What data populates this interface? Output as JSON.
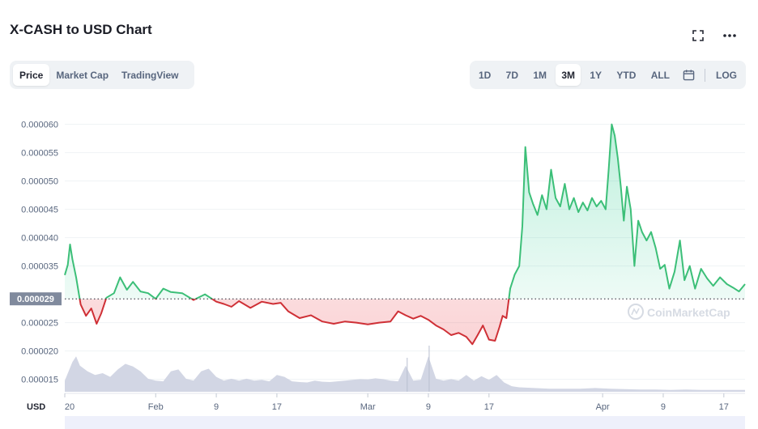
{
  "header": {
    "title": "X-CASH to USD Chart",
    "fullscreen_icon": "fullscreen-icon",
    "more_icon": "more-horizontal-icon"
  },
  "view_tabs": [
    {
      "label": "Price",
      "active": true
    },
    {
      "label": "Market Cap",
      "active": false
    },
    {
      "label": "TradingView",
      "active": false
    }
  ],
  "range_tabs": [
    {
      "label": "1D",
      "active": false
    },
    {
      "label": "7D",
      "active": false
    },
    {
      "label": "1M",
      "active": false
    },
    {
      "label": "3M",
      "active": true
    },
    {
      "label": "1Y",
      "active": false
    },
    {
      "label": "YTD",
      "active": false
    },
    {
      "label": "ALL",
      "active": false
    }
  ],
  "calendar_icon": "calendar-icon",
  "log_label": "LOG",
  "colors": {
    "up": "#16c784",
    "down": "#ea3943",
    "line_up": "#3cbf78",
    "line_down": "#cf3036",
    "volume": "#d2d6e4",
    "grid": "#eff2f5",
    "baseline_badge": "#808a9d"
  },
  "chart_data": {
    "type": "line",
    "currency_label": "USD",
    "y_ticks": [
      "0.000060",
      "0.000055",
      "0.000050",
      "0.000045",
      "0.000040",
      "0.000035",
      "0.000025",
      "0.000020",
      "0.000015"
    ],
    "y_tick_values": [
      6e-05,
      5.5e-05,
      5e-05,
      4.5e-05,
      4e-05,
      3.5e-05,
      2.5e-05,
      2e-05,
      1.5e-05
    ],
    "baseline_label": "0.000029",
    "baseline_value": 2.92e-05,
    "ylim": [
      1.28e-05,
      6.48e-05
    ],
    "x_ticks": [
      {
        "label": "20",
        "day": 0
      },
      {
        "label": "Feb",
        "day": 12
      },
      {
        "label": "9",
        "day": 20
      },
      {
        "label": "17",
        "day": 28
      },
      {
        "label": "Mar",
        "day": 40
      },
      {
        "label": "9",
        "day": 48
      },
      {
        "label": "17",
        "day": 56
      },
      {
        "label": "Apr",
        "day": 71
      },
      {
        "label": "9",
        "day": 79
      },
      {
        "label": "17",
        "day": 87
      }
    ],
    "price_series": [
      [
        0,
        3.34e-05
      ],
      [
        0.4,
        3.52e-05
      ],
      [
        0.7,
        3.88e-05
      ],
      [
        1.0,
        3.62e-05
      ],
      [
        1.5,
        3.3e-05
      ],
      [
        2.1,
        2.82e-05
      ],
      [
        2.8,
        2.62e-05
      ],
      [
        3.5,
        2.75e-05
      ],
      [
        4.2,
        2.48e-05
      ],
      [
        4.8,
        2.66e-05
      ],
      [
        5.5,
        2.94e-05
      ],
      [
        6.5,
        3.02e-05
      ],
      [
        7.3,
        3.3e-05
      ],
      [
        8.2,
        3.08e-05
      ],
      [
        9.0,
        3.22e-05
      ],
      [
        10.0,
        3.05e-05
      ],
      [
        11.0,
        3.02e-05
      ],
      [
        12.0,
        2.92e-05
      ],
      [
        13.0,
        3.1e-05
      ],
      [
        14.0,
        3.04e-05
      ],
      [
        15.5,
        3.02e-05
      ],
      [
        17.0,
        2.9e-05
      ],
      [
        18.5,
        3e-05
      ],
      [
        20.0,
        2.87e-05
      ],
      [
        21.0,
        2.83e-05
      ],
      [
        22.0,
        2.78e-05
      ],
      [
        23.0,
        2.88e-05
      ],
      [
        24.5,
        2.76e-05
      ],
      [
        26.0,
        2.87e-05
      ],
      [
        27.5,
        2.83e-05
      ],
      [
        28.5,
        2.85e-05
      ],
      [
        29.5,
        2.7e-05
      ],
      [
        31.0,
        2.58e-05
      ],
      [
        32.5,
        2.63e-05
      ],
      [
        34.0,
        2.52e-05
      ],
      [
        35.5,
        2.48e-05
      ],
      [
        37.0,
        2.52e-05
      ],
      [
        38.5,
        2.5e-05
      ],
      [
        40.0,
        2.47e-05
      ],
      [
        41.5,
        2.5e-05
      ],
      [
        43.0,
        2.52e-05
      ],
      [
        44.0,
        2.7e-05
      ],
      [
        45.0,
        2.63e-05
      ],
      [
        46.0,
        2.57e-05
      ],
      [
        47.0,
        2.62e-05
      ],
      [
        48.0,
        2.55e-05
      ],
      [
        49.0,
        2.45e-05
      ],
      [
        50.0,
        2.38e-05
      ],
      [
        51.0,
        2.28e-05
      ],
      [
        52.0,
        2.32e-05
      ],
      [
        53.0,
        2.25e-05
      ],
      [
        53.8,
        2.12e-05
      ],
      [
        54.5,
        2.28e-05
      ],
      [
        55.2,
        2.45e-05
      ],
      [
        56.0,
        2.2e-05
      ],
      [
        56.8,
        2.18e-05
      ],
      [
        57.4,
        2.43e-05
      ],
      [
        57.8,
        2.62e-05
      ],
      [
        58.3,
        2.58e-05
      ],
      [
        58.8,
        3.1e-05
      ],
      [
        59.4,
        3.35e-05
      ],
      [
        60.0,
        3.5e-05
      ],
      [
        60.4,
        4.2e-05
      ],
      [
        60.8,
        5.6e-05
      ],
      [
        61.3,
        4.8e-05
      ],
      [
        61.8,
        4.6e-05
      ],
      [
        62.4,
        4.4e-05
      ],
      [
        63.0,
        4.75e-05
      ],
      [
        63.6,
        4.5e-05
      ],
      [
        64.2,
        5.2e-05
      ],
      [
        64.8,
        4.7e-05
      ],
      [
        65.4,
        4.55e-05
      ],
      [
        66.0,
        4.95e-05
      ],
      [
        66.6,
        4.5e-05
      ],
      [
        67.2,
        4.7e-05
      ],
      [
        67.8,
        4.45e-05
      ],
      [
        68.4,
        4.62e-05
      ],
      [
        69.0,
        4.48e-05
      ],
      [
        69.6,
        4.7e-05
      ],
      [
        70.2,
        4.55e-05
      ],
      [
        70.8,
        4.65e-05
      ],
      [
        71.4,
        4.5e-05
      ],
      [
        71.8,
        5.2e-05
      ],
      [
        72.2,
        6e-05
      ],
      [
        72.6,
        5.8e-05
      ],
      [
        73.0,
        5.4e-05
      ],
      [
        73.4,
        4.9e-05
      ],
      [
        73.8,
        4.3e-05
      ],
      [
        74.2,
        4.9e-05
      ],
      [
        74.7,
        4.5e-05
      ],
      [
        75.2,
        3.5e-05
      ],
      [
        75.7,
        4.3e-05
      ],
      [
        76.2,
        4.1e-05
      ],
      [
        76.8,
        3.95e-05
      ],
      [
        77.4,
        4.1e-05
      ],
      [
        78.0,
        3.82e-05
      ],
      [
        78.6,
        3.45e-05
      ],
      [
        79.2,
        3.52e-05
      ],
      [
        79.8,
        3.1e-05
      ],
      [
        80.5,
        3.4e-05
      ],
      [
        81.2,
        3.95e-05
      ],
      [
        81.8,
        3.25e-05
      ],
      [
        82.5,
        3.5e-05
      ],
      [
        83.2,
        3.1e-05
      ],
      [
        84.0,
        3.45e-05
      ],
      [
        84.8,
        3.28e-05
      ],
      [
        85.6,
        3.15e-05
      ],
      [
        86.5,
        3.3e-05
      ],
      [
        87.4,
        3.18e-05
      ],
      [
        88.2,
        3.12e-05
      ],
      [
        89.0,
        3.05e-05
      ],
      [
        89.8,
        3.18e-05
      ]
    ],
    "volume_series": [
      [
        0,
        0.3
      ],
      [
        1,
        0.8
      ],
      [
        1.5,
        0.95
      ],
      [
        2,
        0.7
      ],
      [
        3,
        0.55
      ],
      [
        4,
        0.45
      ],
      [
        5,
        0.5
      ],
      [
        6,
        0.4
      ],
      [
        7,
        0.6
      ],
      [
        8,
        0.75
      ],
      [
        9,
        0.68
      ],
      [
        10,
        0.55
      ],
      [
        11,
        0.35
      ],
      [
        12,
        0.3
      ],
      [
        13,
        0.28
      ],
      [
        14,
        0.55
      ],
      [
        15,
        0.6
      ],
      [
        16,
        0.35
      ],
      [
        17,
        0.3
      ],
      [
        18,
        0.55
      ],
      [
        19,
        0.62
      ],
      [
        20,
        0.4
      ],
      [
        21,
        0.3
      ],
      [
        22,
        0.35
      ],
      [
        23,
        0.3
      ],
      [
        24,
        0.35
      ],
      [
        25,
        0.3
      ],
      [
        26,
        0.32
      ],
      [
        27,
        0.28
      ],
      [
        28,
        0.45
      ],
      [
        29,
        0.4
      ],
      [
        30,
        0.28
      ],
      [
        31,
        0.26
      ],
      [
        32,
        0.25
      ],
      [
        33,
        0.3
      ],
      [
        34,
        0.27
      ],
      [
        35,
        0.26
      ],
      [
        36,
        0.28
      ],
      [
        37,
        0.3
      ],
      [
        38,
        0.32
      ],
      [
        39,
        0.34
      ],
      [
        40,
        0.33
      ],
      [
        41,
        0.36
      ],
      [
        42,
        0.34
      ],
      [
        43,
        0.3
      ],
      [
        44,
        0.28
      ],
      [
        45,
        0.7
      ],
      [
        46,
        0.3
      ],
      [
        47,
        0.32
      ],
      [
        48,
        0.95
      ],
      [
        49,
        0.35
      ],
      [
        50,
        0.3
      ],
      [
        51,
        0.34
      ],
      [
        52,
        0.3
      ],
      [
        53,
        0.45
      ],
      [
        54,
        0.3
      ],
      [
        55,
        0.42
      ],
      [
        56,
        0.32
      ],
      [
        57,
        0.45
      ],
      [
        58,
        0.25
      ],
      [
        59,
        0.15
      ],
      [
        60,
        0.12
      ],
      [
        62,
        0.1
      ],
      [
        64,
        0.08
      ],
      [
        66,
        0.08
      ],
      [
        68,
        0.08
      ],
      [
        70,
        0.1
      ],
      [
        72,
        0.08
      ],
      [
        74,
        0.07
      ],
      [
        76,
        0.06
      ],
      [
        78,
        0.06
      ],
      [
        80,
        0.05
      ],
      [
        82,
        0.06
      ],
      [
        84,
        0.05
      ],
      [
        86,
        0.05
      ],
      [
        88,
        0.05
      ],
      [
        89.8,
        0.05
      ]
    ],
    "xlim": [
      0,
      89.8
    ],
    "watermark": "CoinMarketCap"
  }
}
